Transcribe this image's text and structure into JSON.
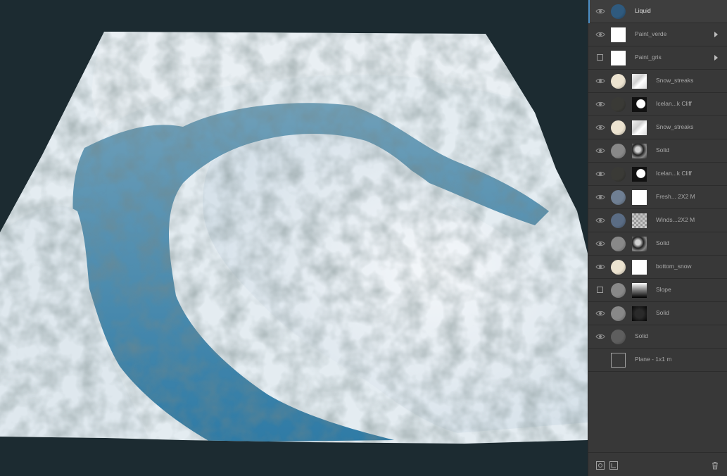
{
  "viewport": {
    "scene": "terrain-render"
  },
  "layers": [
    {
      "name": "Liquid",
      "visible": true,
      "selected": true,
      "thumb1": "#2f5a7e",
      "thumb1_shape": "circle",
      "thumb2": null,
      "has_arrow": false
    },
    {
      "name": "Paint_verde",
      "visible": true,
      "selected": false,
      "thumb1": "#ffffff",
      "thumb1_shape": "square",
      "thumb2": null,
      "has_arrow": true
    },
    {
      "name": "Paint_gris",
      "visible": false,
      "selected": false,
      "thumb1": "#ffffff",
      "thumb1_shape": "square",
      "thumb2": null,
      "has_arrow": true
    },
    {
      "name": "Snow_streaks",
      "visible": true,
      "selected": false,
      "thumb1": "#ece3d0",
      "thumb1_shape": "circle",
      "thumb2": "pattern-streaks",
      "has_arrow": false
    },
    {
      "name": "Icelan...k Cliff",
      "visible": true,
      "selected": false,
      "thumb1": "#3a3a36",
      "thumb1_shape": "circle",
      "thumb2": "pattern-mask-dark",
      "has_arrow": false
    },
    {
      "name": "Snow_streaks",
      "visible": true,
      "selected": false,
      "thumb1": "#ece3d0",
      "thumb1_shape": "circle",
      "thumb2": "pattern-streaks",
      "has_arrow": false
    },
    {
      "name": "Solid",
      "visible": true,
      "selected": false,
      "thumb1": "#888888",
      "thumb1_shape": "circle",
      "thumb2": "pattern-noise",
      "has_arrow": false
    },
    {
      "name": "Icelan...k Cliff",
      "visible": true,
      "selected": false,
      "thumb1": "#3a3a36",
      "thumb1_shape": "circle",
      "thumb2": "pattern-mask-dark",
      "has_arrow": false
    },
    {
      "name": "Fresh... 2X2 M",
      "visible": true,
      "selected": false,
      "thumb1": "#6f7f93",
      "thumb1_shape": "circle",
      "thumb2": "white",
      "has_arrow": false
    },
    {
      "name": "Winds...2X2 M",
      "visible": true,
      "selected": false,
      "thumb1": "#5a6c84",
      "thumb1_shape": "circle",
      "thumb2": "pattern-checker",
      "has_arrow": false
    },
    {
      "name": "Solid",
      "visible": true,
      "selected": false,
      "thumb1": "#888888",
      "thumb1_shape": "circle",
      "thumb2": "pattern-noise",
      "has_arrow": false
    },
    {
      "name": "bottom_snow",
      "visible": true,
      "selected": false,
      "thumb1": "#ece3d0",
      "thumb1_shape": "circle",
      "thumb2": "white",
      "has_arrow": false
    },
    {
      "name": "Slope",
      "visible": false,
      "selected": false,
      "thumb1": "#888888",
      "thumb1_shape": "circle",
      "thumb2": "pattern-gradient",
      "has_arrow": false
    },
    {
      "name": "Solid",
      "visible": true,
      "selected": false,
      "thumb1": "#888888",
      "thumb1_shape": "circle",
      "thumb2": "pattern-dark",
      "has_arrow": false
    },
    {
      "name": "Solid",
      "visible": true,
      "selected": false,
      "thumb1": "#5e5e5e",
      "thumb1_shape": "circle",
      "thumb2": null,
      "has_arrow": false
    },
    {
      "name": "Plane - 1x1 m",
      "visible": null,
      "selected": false,
      "thumb1": "outline",
      "thumb1_shape": "square",
      "thumb2": null,
      "has_arrow": false
    }
  ],
  "footer": {
    "icons": [
      "add-layer-icon",
      "add-mask-icon",
      "trash-icon"
    ]
  },
  "colors": {
    "accent": "#4a90c8",
    "panel_bg": "#383838",
    "viewport_bg": "#1c2b31"
  }
}
